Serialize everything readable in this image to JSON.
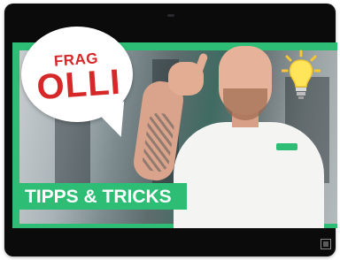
{
  "thumbnail": {
    "bubble_line1": "FRAG",
    "bubble_line2": "OLLI",
    "banner_text": "TIPPS & TRICKS",
    "accent_color": "#2dbd74",
    "bubble_text_color": "#d62828",
    "icon": "lightbulb-icon"
  },
  "controls": {
    "expand_icon": "fullscreen-icon"
  }
}
